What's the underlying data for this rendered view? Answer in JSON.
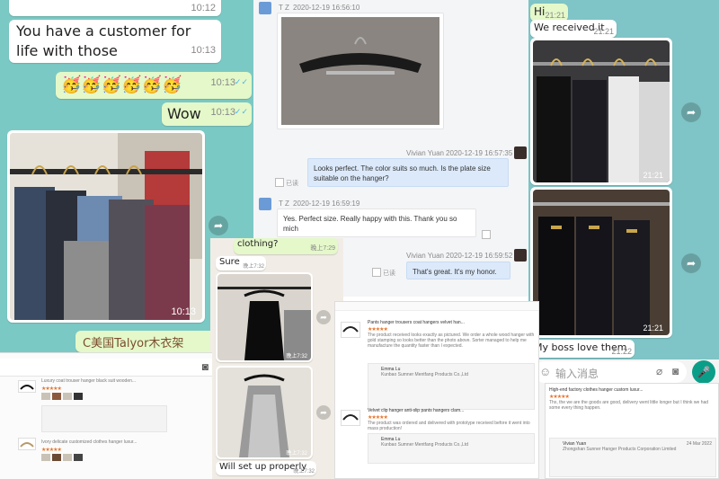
{
  "whatsapp_left": {
    "msg_top_time": "10:12",
    "msg_customer": "You have a customer for life with those",
    "msg_customer_time": "10:13",
    "emoji_row": "🥳🥳🥳🥳🥳🥳",
    "emoji_time": "10:13",
    "msg_wow": "Wow",
    "msg_wow_time": "10:13",
    "photo_time": "10:13",
    "msg_bottom": "C美国Talyor木衣架"
  },
  "qq_chat": {
    "msg1_sender": "T Z",
    "msg1_time": "2020-12-19 16:56:10",
    "msg2_sender": "Vivian Yuan",
    "msg2_time": "2020-12-19 16:57:35",
    "msg2_text": "Looks perfect. The color suits so much. Is the plate size suitable on the hanger?",
    "read_label": "已读",
    "msg3_sender": "T Z",
    "msg3_time": "2020-12-19 16:59:19",
    "msg3_text": "Yes. Perfect size. Really happy with this. Thank you so mich",
    "msg4_sender": "Vivian Yuan",
    "msg4_time": "2020-12-19 16:59:52",
    "msg4_text": "That's great. It's my honor."
  },
  "whatsapp_right": {
    "msg_hi": "Hi",
    "msg_hi_time": "21:21",
    "msg_received": "We received it",
    "msg_received_time": "21:21",
    "photo1_time": "21:21",
    "photo2_time": "21:21",
    "msg_boss": "My boss love them",
    "msg_boss_time": "21:22",
    "input_placeholder": "输入消息"
  },
  "whatsapp_mid": {
    "msg_clothing": "clothing?",
    "msg_clothing_time": "晚上7:29",
    "msg_sure": "Sure",
    "msg_sure_time": "晚上7:32",
    "photo1_time": "晚上7:32",
    "photo2_time": "晚上7:32",
    "msg_setup": "Will set up properly",
    "msg_setup_time": "晚上7:32"
  },
  "reviews_center": {
    "review1_title": "Pants hanger trousers coat hangers velvet han...",
    "review1_text": "The product received looks exactly as pictured. We order a whole wood hanger with gold stamping so looks better than the photo above. Sorter managed to help me manufacture the quantity faster than I expected.",
    "reply_name": "Emma Lu",
    "reply_company": "Kunbao Sumner Mentfang Products Co.,Ltd",
    "review2_title": "Velvet clip hanger anti-slip pants hangers clam...",
    "review2_text": "The product was ordered and delivered with prototype received before it went into mass production!"
  },
  "reviews_right": {
    "title": "High-end factory clothes hanger custom luxur...",
    "text": "Thx, the we are the goods are good, delivery went little longer but I think we had some every thing happen.",
    "reply_name": "Vivian Yuan",
    "reply_company": "Zhongshan Sunner Hanger Products Corporation Limited",
    "reply_date": "24 Mar 2022"
  },
  "reviews_left": {
    "item1": "Luxury coat trouser hanger black suit wooden...",
    "item2": "Ivory delicate customized clothes hanger luxur..."
  },
  "colors": {
    "whatsapp_bg": "#7bc9c5",
    "outgoing_bubble": "#e4f8c9",
    "qq_outgoing": "#dbe9fa",
    "read_check": "#4fb3f0",
    "star": "#e8742b"
  }
}
